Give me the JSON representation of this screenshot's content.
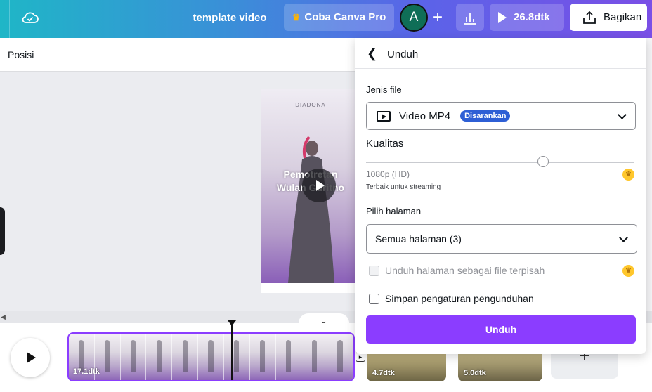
{
  "topbar": {
    "title": "template video",
    "pro_label": "Coba Canva Pro",
    "avatar_initial": "A",
    "duration_label": "26.8dtk",
    "share_label": "Bagikan"
  },
  "subbar": {
    "position_label": "Posisi"
  },
  "design_page": {
    "brand": "DIADONA",
    "title_line1": "Pemotretan",
    "title_line2": "Wulan Guritno"
  },
  "timeline": {
    "clips": [
      {
        "duration": "17.1dtk"
      },
      {
        "duration": "4.7dtk"
      },
      {
        "duration": "5.0dtk"
      }
    ],
    "add_label": "+"
  },
  "download_panel": {
    "title": "Unduh",
    "file_type_label": "Jenis file",
    "file_type_value": "Video MP4",
    "recommended_badge": "Disarankan",
    "quality_label": "Kualitas",
    "quality_value": "1080p (HD)",
    "quality_note": "Terbaik untuk streaming",
    "quality_level": 0.66,
    "pages_label": "Pilih halaman",
    "pages_value": "Semua halaman (3)",
    "separate_files_label": "Unduh halaman sebagai file terpisah",
    "save_settings_label": "Simpan pengaturan pengunduhan",
    "download_button": "Unduh"
  },
  "colors": {
    "accent": "#8b3dff",
    "badge_blue": "#2e5fd5",
    "crown": "#ffc72c"
  }
}
